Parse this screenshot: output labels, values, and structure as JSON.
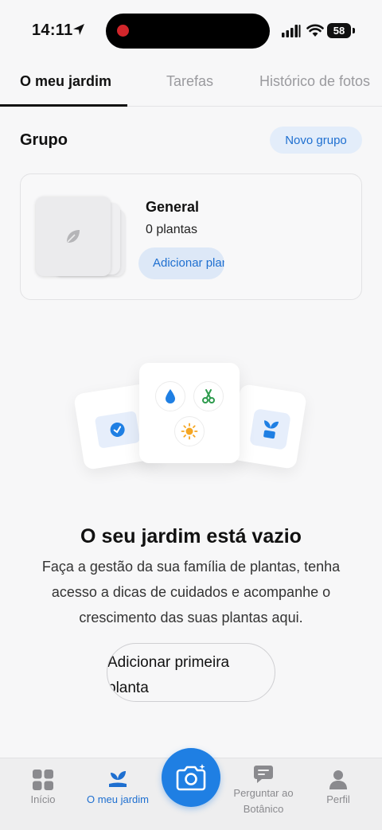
{
  "status_bar": {
    "time": "14:11",
    "battery": "58",
    "battery_level": 0.58
  },
  "tabs": [
    {
      "label": "O meu jardim",
      "active": true
    },
    {
      "label": "Tarefas",
      "active": false
    },
    {
      "label": "Histórico de fotos",
      "active": false
    }
  ],
  "group": {
    "title": "Grupo",
    "new_group_label": "Novo grupo",
    "card": {
      "name": "General",
      "count": "0 plantas",
      "add_label": "Adicionar plantas",
      "thumb_icon": "leaf-icon"
    }
  },
  "illustration": {
    "icons": [
      "water-drop-icon",
      "scissors-icon",
      "sun-icon",
      "calendar-check-icon",
      "sprout-icon"
    ]
  },
  "empty_state": {
    "title": "O seu jardim está vazio",
    "description": "Faça a gestão da sua família de plantas, tenha acesso a dicas de cuidados e acompanhe o crescimento das suas plantas aqui.",
    "button_label": "Adicionar primeira planta"
  },
  "bottom_nav": {
    "items": [
      {
        "label": "Início",
        "icon": "grid-icon",
        "active": false
      },
      {
        "label": "O meu jardim",
        "icon": "plant-icon",
        "active": true
      },
      {
        "label": "Perguntar ao Botânico",
        "icon": "chat-icon",
        "active": false
      },
      {
        "label": "Perfil",
        "icon": "profile-icon",
        "active": false
      }
    ],
    "camera_icon": "camera-icon"
  },
  "colors": {
    "accent": "#1f7fe3",
    "link": "#1e6fd0",
    "chip_bg": "#e3edfa",
    "background": "#f7f7f8"
  }
}
